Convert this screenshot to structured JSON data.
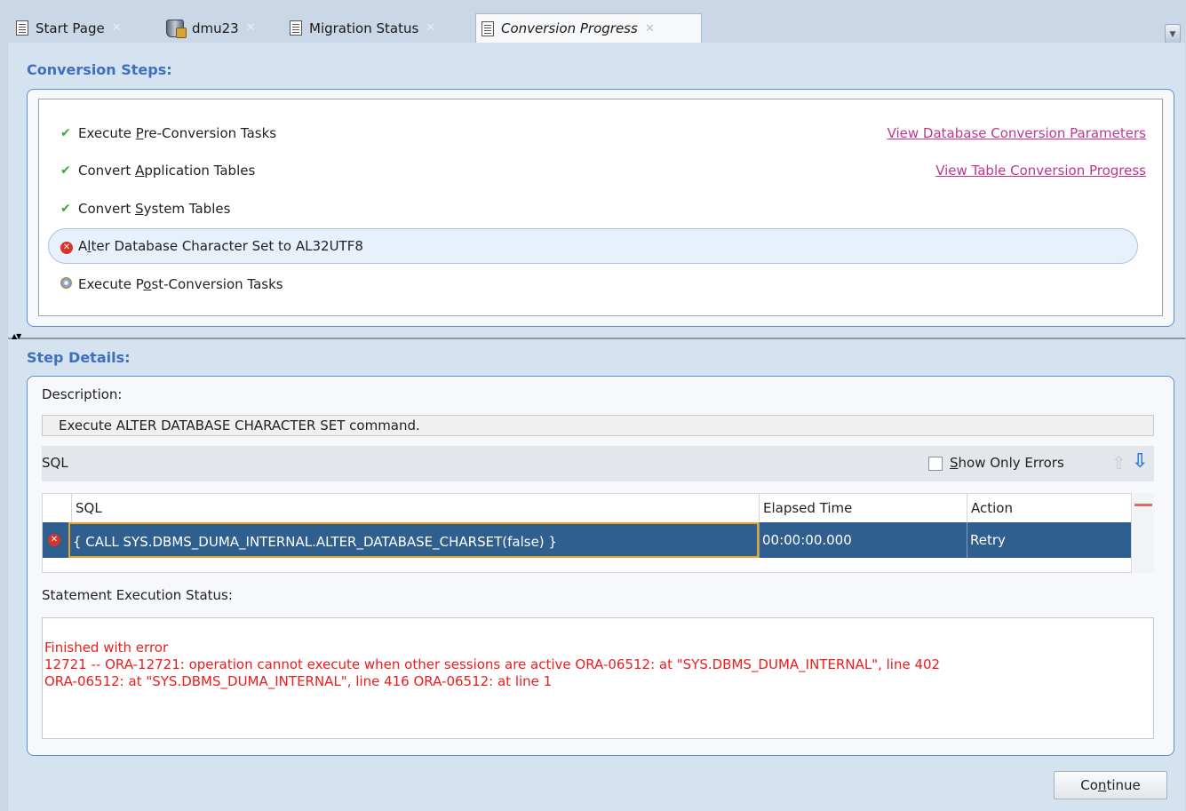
{
  "tabs": [
    {
      "label": "Start Page",
      "icon": "document-icon"
    },
    {
      "label": "dmu23",
      "icon": "database-icon"
    },
    {
      "label": "Migration Status",
      "icon": "document-icon"
    },
    {
      "label": "Conversion Progress",
      "icon": "document-icon",
      "active": true
    }
  ],
  "conversion_steps": {
    "title": "Conversion Steps:",
    "steps": [
      {
        "pre": "Execute ",
        "mn": "P",
        "post": "re-Conversion Tasks",
        "status": "completed"
      },
      {
        "pre": "Convert ",
        "mn": "A",
        "post": "pplication Tables",
        "status": "completed"
      },
      {
        "pre": "Convert ",
        "mn": "S",
        "post": "ystem Tables",
        "status": "completed"
      },
      {
        "pre": "A",
        "mn": "l",
        "post": "ter Database Character Set to AL32UTF8",
        "status": "error"
      },
      {
        "pre": "Execute P",
        "mn": "o",
        "post": "st-Conversion Tasks",
        "status": "pending"
      }
    ],
    "links": {
      "parameters": "View Database Conversion Parameters",
      "table_progress": "View Table Conversion Progress"
    }
  },
  "step_details": {
    "title": "Step Details:",
    "description_label": "Description:",
    "description": "Execute ALTER DATABASE CHARACTER SET command.",
    "sql_label": "SQL",
    "show_errors": {
      "mn": "S",
      "rest": "how Only Errors",
      "checked": false
    },
    "table": {
      "columns": [
        "SQL",
        "Elapsed Time",
        "Action"
      ],
      "rows": [
        {
          "status": "error",
          "sql": "{ CALL SYS.DBMS_DUMA_INTERNAL.ALTER_DATABASE_CHARSET(false) }",
          "elapsed": "00:00:00.000",
          "action": "Retry"
        }
      ]
    },
    "status_label": "Statement Execution Status:",
    "status_lines": [
      "Finished with error",
      "12721 -- ORA-12721: operation cannot execute when other sessions are active ORA-06512: at \"SYS.DBMS_DUMA_INTERNAL\", line 402",
      "ORA-06512: at \"SYS.DBMS_DUMA_INTERNAL\", line 416 ORA-06512: at line 1"
    ]
  },
  "footer": {
    "continue": {
      "pre": "Co",
      "mn": "n",
      "post": "tinue"
    }
  },
  "colors": {
    "section_title": "#3f6fbf",
    "link": "#c0368e",
    "error_text": "#ee1c1c",
    "selected_row": "#2f5f8e"
  }
}
